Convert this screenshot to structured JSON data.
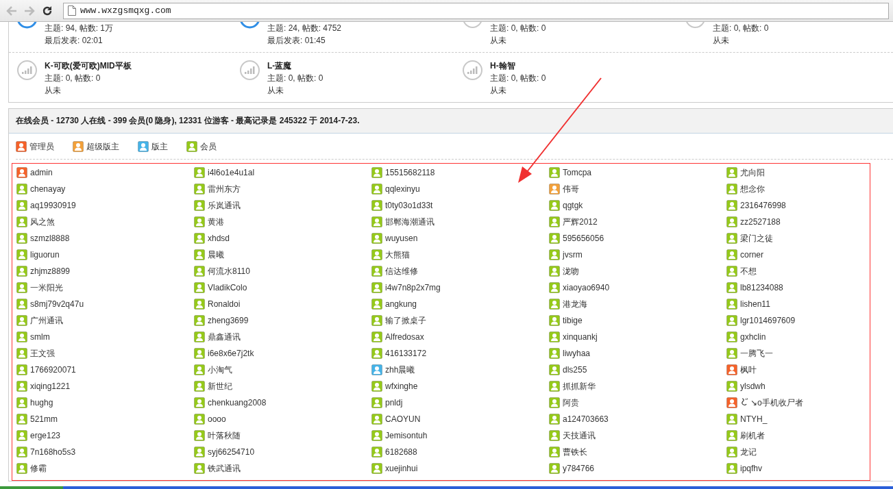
{
  "browser": {
    "back_disabled": true,
    "forward_disabled": true,
    "url": "www.wxzgsmqxg.com"
  },
  "forums": [
    {
      "new": true,
      "stats": "主题: 94, 帖数: 1万",
      "last": "最后发表: 02:01"
    },
    {
      "new": true,
      "stats": "主题: 24, 帖数: 4752",
      "last": "最后发表: 01:45"
    },
    {
      "new": false,
      "stats": "主题: 0, 帖数: 0",
      "last": "从未"
    },
    {
      "new": false,
      "stats": "主题: 0, 帖数: 0",
      "last": "从未"
    },
    {
      "new": false,
      "title": "K-可欧(爱可欧)MID平板",
      "stats": "主题: 0, 帖数: 0",
      "last": "从未"
    },
    {
      "new": false,
      "title": "L-蓝魔",
      "stats": "主题: 0, 帖数: 0",
      "last": "从未"
    },
    {
      "new": false,
      "title": "H-翰智",
      "stats": "主题: 0, 帖数: 0",
      "last": "从未"
    }
  ],
  "online": {
    "header": "在线会员 - 12730 人在线 - 399 会员(0 隐身), 12331 位游客 - 最高记录是 245322 于 2014-7-23.",
    "legend": [
      {
        "kind": "admin",
        "label": "管理员"
      },
      {
        "kind": "super",
        "label": "超级版主"
      },
      {
        "kind": "mod",
        "label": "版主"
      },
      {
        "kind": "member",
        "label": "会员"
      }
    ],
    "members": [
      {
        "kind": "admin",
        "name": "admin"
      },
      {
        "kind": "member",
        "name": "i4l6o1e4u1al"
      },
      {
        "kind": "member",
        "name": "15515682118"
      },
      {
        "kind": "member",
        "name": "Tomcpa"
      },
      {
        "kind": "member",
        "name": "尤向阳"
      },
      {
        "kind": "member",
        "name": "chenayay"
      },
      {
        "kind": "member",
        "name": "雷州东方"
      },
      {
        "kind": "member",
        "name": "qqlexinyu"
      },
      {
        "kind": "super",
        "name": "伟哥"
      },
      {
        "kind": "member",
        "name": "想念你"
      },
      {
        "kind": "member",
        "name": "aq19930919"
      },
      {
        "kind": "member",
        "name": "乐岚通讯"
      },
      {
        "kind": "member",
        "name": "t0ty03o1d33t"
      },
      {
        "kind": "member",
        "name": "qgtgk"
      },
      {
        "kind": "member",
        "name": "2316476998"
      },
      {
        "kind": "member",
        "name": "风之煞"
      },
      {
        "kind": "member",
        "name": "黄港"
      },
      {
        "kind": "member",
        "name": "邯郸海潮通讯"
      },
      {
        "kind": "member",
        "name": "严辉2012"
      },
      {
        "kind": "member",
        "name": "zz2527188"
      },
      {
        "kind": "member",
        "name": "szmzl8888"
      },
      {
        "kind": "member",
        "name": "xhdsd"
      },
      {
        "kind": "member",
        "name": "wuyusen"
      },
      {
        "kind": "member",
        "name": "595656056"
      },
      {
        "kind": "member",
        "name": "梁门之徒"
      },
      {
        "kind": "member",
        "name": "liguorun"
      },
      {
        "kind": "member",
        "name": "晨曦"
      },
      {
        "kind": "member",
        "name": "大熊猫"
      },
      {
        "kind": "member",
        "name": "jvsrm"
      },
      {
        "kind": "member",
        "name": "corner"
      },
      {
        "kind": "member",
        "name": "zhjmz8899"
      },
      {
        "kind": "member",
        "name": "何流水8110"
      },
      {
        "kind": "member",
        "name": "信达维修"
      },
      {
        "kind": "member",
        "name": "泷吻"
      },
      {
        "kind": "member",
        "name": "不想"
      },
      {
        "kind": "member",
        "name": "一米阳光"
      },
      {
        "kind": "member",
        "name": "VladikColo"
      },
      {
        "kind": "member",
        "name": "i4w7n8p2x7mg"
      },
      {
        "kind": "member",
        "name": "xiaoyao6940"
      },
      {
        "kind": "member",
        "name": "lb81234088"
      },
      {
        "kind": "member",
        "name": "s8mj79v2q47u"
      },
      {
        "kind": "member",
        "name": "Ronaldoi"
      },
      {
        "kind": "member",
        "name": "angkung"
      },
      {
        "kind": "member",
        "name": "港龙海"
      },
      {
        "kind": "member",
        "name": "lishen11"
      },
      {
        "kind": "member",
        "name": "广州通讯"
      },
      {
        "kind": "member",
        "name": "zheng3699"
      },
      {
        "kind": "member",
        "name": "输了掀桌子"
      },
      {
        "kind": "member",
        "name": "tibige"
      },
      {
        "kind": "member",
        "name": "lgr1014697609"
      },
      {
        "kind": "member",
        "name": "smlm"
      },
      {
        "kind": "member",
        "name": "鼎鑫通讯"
      },
      {
        "kind": "member",
        "name": "Alfredosax"
      },
      {
        "kind": "member",
        "name": "xinquankj"
      },
      {
        "kind": "member",
        "name": "gxhclin"
      },
      {
        "kind": "member",
        "name": "王文强"
      },
      {
        "kind": "member",
        "name": "i6e8x6e7j2tk"
      },
      {
        "kind": "member",
        "name": "416133172"
      },
      {
        "kind": "member",
        "name": "liwyhaa"
      },
      {
        "kind": "member",
        "name": "一腾飞一"
      },
      {
        "kind": "member",
        "name": "1766920071"
      },
      {
        "kind": "member",
        "name": "小淘气"
      },
      {
        "kind": "mod",
        "name": "zhh晨曦"
      },
      {
        "kind": "member",
        "name": "dls255"
      },
      {
        "kind": "admin",
        "name": "枫叶"
      },
      {
        "kind": "member",
        "name": "xiqing1221"
      },
      {
        "kind": "member",
        "name": "新世纪"
      },
      {
        "kind": "member",
        "name": "wfxinghe"
      },
      {
        "kind": "member",
        "name": "抓抓新华"
      },
      {
        "kind": "member",
        "name": "ylsdwh"
      },
      {
        "kind": "member",
        "name": "hughg"
      },
      {
        "kind": "member",
        "name": "chenkuang2008"
      },
      {
        "kind": "member",
        "name": "pnldj"
      },
      {
        "kind": "member",
        "name": "阿贵"
      },
      {
        "kind": "admin",
        "symbol": true,
        "name": "↘o手机收尸者"
      },
      {
        "kind": "member",
        "name": "521mm"
      },
      {
        "kind": "member",
        "name": "oooo"
      },
      {
        "kind": "member",
        "name": "CAOYUN"
      },
      {
        "kind": "member",
        "name": "a124703663"
      },
      {
        "kind": "member",
        "name": "NTYH_"
      },
      {
        "kind": "member",
        "name": "erge123"
      },
      {
        "kind": "member",
        "name": "叶落秋随"
      },
      {
        "kind": "member",
        "name": "Jemisontuh"
      },
      {
        "kind": "member",
        "name": "天技通讯"
      },
      {
        "kind": "member",
        "name": "刷机者"
      },
      {
        "kind": "member",
        "name": "7n168ho5s3"
      },
      {
        "kind": "member",
        "name": "syj66254710"
      },
      {
        "kind": "member",
        "name": "6182688"
      },
      {
        "kind": "member",
        "name": "曹铁长"
      },
      {
        "kind": "member",
        "name": "龙记"
      },
      {
        "kind": "member",
        "name": "修霸"
      },
      {
        "kind": "member",
        "name": "铁武通讯"
      },
      {
        "kind": "member",
        "name": "xuejinhui"
      },
      {
        "kind": "member",
        "name": "y784766"
      },
      {
        "kind": "member",
        "name": "ipqfhv"
      }
    ]
  }
}
